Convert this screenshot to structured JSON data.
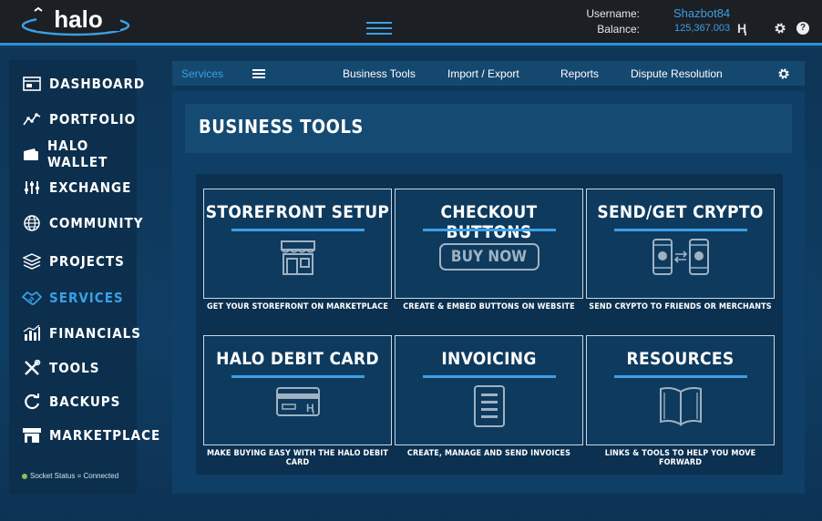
{
  "header": {
    "logo_text": "halo",
    "username_label": "Username:",
    "username": "Shazbot84",
    "balance_label": "Balance:",
    "balance": "125,367.003",
    "currency_glyph": "Ⱨ",
    "help_glyph": "?"
  },
  "sidebar": {
    "items": [
      {
        "label": "DASHBOARD",
        "icon": "window-icon"
      },
      {
        "label": "PORTFOLIO",
        "icon": "line-graph-icon"
      },
      {
        "label": "HALO WALLET",
        "icon": "wallet-icon"
      },
      {
        "label": "EXCHANGE",
        "icon": "sliders-icon"
      },
      {
        "label": "COMMUNITY",
        "icon": "globe-icon"
      },
      {
        "label": "PROJECTS",
        "icon": "layers-icon"
      },
      {
        "label": "SERVICES",
        "icon": "handshake-icon",
        "active": true
      },
      {
        "label": "FINANCIALS",
        "icon": "bar-chart-icon"
      },
      {
        "label": "TOOLS",
        "icon": "tools-icon"
      },
      {
        "label": "BACKUPS",
        "icon": "refresh-icon"
      },
      {
        "label": "MARKETPLACE",
        "icon": "store-icon"
      }
    ],
    "socket_status": "Socket Status = Connected"
  },
  "subnav": {
    "current": "Services",
    "links": [
      "Business Tools",
      "Import / Export",
      "Reports",
      "Dispute Resolution"
    ]
  },
  "main": {
    "title": "BUSINESS TOOLS",
    "tiles": [
      {
        "title": "STOREFRONT SETUP",
        "caption": "GET YOUR STOREFRONT ON MARKETPLACE",
        "icon": "storefront-icon"
      },
      {
        "title": "CHECKOUT BUTTONS",
        "caption": "CREATE & EMBED BUTTONS ON WEBSITE",
        "icon": "buy-now-button",
        "button_label": "BUY NOW"
      },
      {
        "title": "SEND/GET CRYPTO",
        "caption": "SEND CRYPTO TO FRIENDS OR MERCHANTS",
        "icon": "phones-transfer-icon"
      },
      {
        "title": "HALO DEBIT CARD",
        "caption": "MAKE BUYING EASY WITH THE HALO DEBIT CARD",
        "icon": "debit-card-icon"
      },
      {
        "title": "INVOICING",
        "caption": "CREATE, MANAGE AND SEND INVOICES",
        "icon": "invoice-icon"
      },
      {
        "title": "RESOURCES",
        "caption": "LINKS & TOOLS TO HELP YOU MOVE FORWARD",
        "icon": "book-icon"
      }
    ]
  },
  "colors": {
    "accent": "#3aa0e6",
    "topbar": "#1c1f23",
    "panel": "#0f3f66",
    "status_ok": "#8bc34a"
  }
}
